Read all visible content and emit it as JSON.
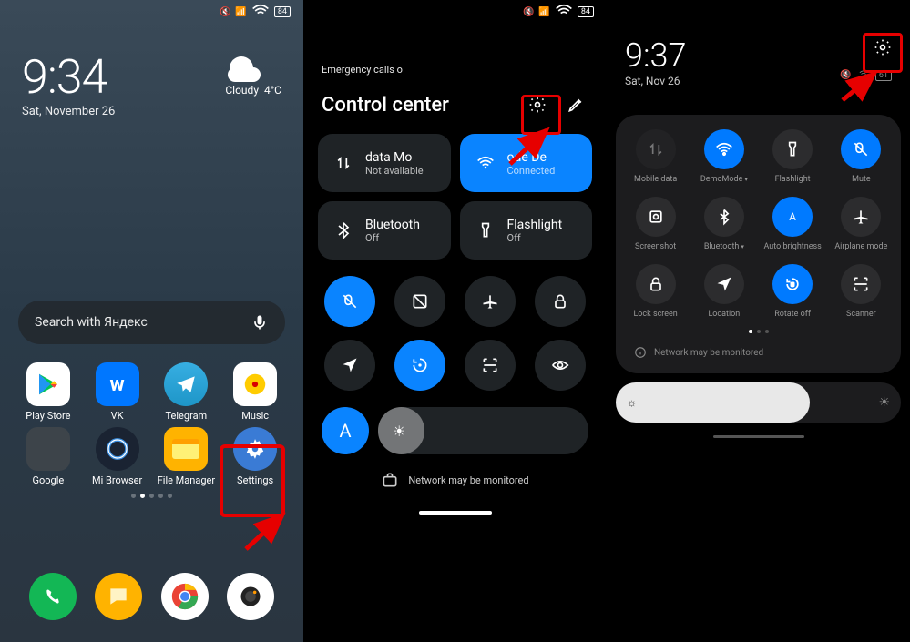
{
  "home": {
    "status": {
      "battery": "84"
    },
    "clock": {
      "time": "9:34",
      "date": "Sat, November 26"
    },
    "weather": {
      "label": "Cloudy",
      "temp": "4°C"
    },
    "search": {
      "placeholder": "Search with Яндекс"
    },
    "apps_row1": [
      {
        "name": "Play Store",
        "bg": "#fff"
      },
      {
        "name": "VK",
        "bg": "#0077ff"
      },
      {
        "name": "Telegram",
        "bg": "#2aa1da"
      },
      {
        "name": "Music",
        "bg": "#fff"
      }
    ],
    "apps_row2": [
      {
        "name": "Google",
        "bg": "folder"
      },
      {
        "name": "Mi Browser",
        "bg": "#1a2332"
      },
      {
        "name": "File Manager",
        "bg": "#ffb300"
      },
      {
        "name": "Settings",
        "bg": "#0a84ff"
      }
    ]
  },
  "cc": {
    "emergency": "Emergency calls o",
    "status": {
      "battery": "84"
    },
    "title": "Control center",
    "tiles": [
      {
        "icon": "data",
        "main": "data   Mo",
        "sub": "Not available",
        "active": false
      },
      {
        "icon": "wifi",
        "main": "ode   De",
        "sub": "Connected",
        "active": true
      },
      {
        "icon": "bt",
        "main": "Bluetooth",
        "sub": "Off",
        "active": false
      },
      {
        "icon": "flash",
        "main": "Flashlight",
        "sub": "Off",
        "active": false
      }
    ],
    "icon_grid": [
      {
        "name": "mute",
        "active": true
      },
      {
        "name": "screenshot",
        "active": false
      },
      {
        "name": "airplane",
        "active": false
      },
      {
        "name": "lock",
        "active": false
      },
      {
        "name": "location",
        "active": false
      },
      {
        "name": "rotate",
        "active": true
      },
      {
        "name": "scanner",
        "active": false
      },
      {
        "name": "eye",
        "active": false
      }
    ],
    "auto_label": "A",
    "monitored": "Network may be monitored"
  },
  "qs": {
    "time": "9:37",
    "date": "Sat, Nov 26",
    "battery": "61",
    "items": [
      {
        "label": "Mobile data",
        "active": false,
        "disabled": true
      },
      {
        "label": "DemoMode",
        "active": true,
        "arrow": true
      },
      {
        "label": "Flashlight",
        "active": false
      },
      {
        "label": "Mute",
        "active": true
      },
      {
        "label": "Screenshot",
        "active": false
      },
      {
        "label": "Bluetooth",
        "active": false,
        "arrow": true
      },
      {
        "label": "Auto brightness",
        "active": true
      },
      {
        "label": "Airplane mode",
        "active": false
      },
      {
        "label": "Lock screen",
        "active": false
      },
      {
        "label": "Location",
        "active": false
      },
      {
        "label": "Rotate off",
        "active": true
      },
      {
        "label": "Scanner",
        "active": false
      }
    ],
    "monitored": "Network may be monitored"
  }
}
